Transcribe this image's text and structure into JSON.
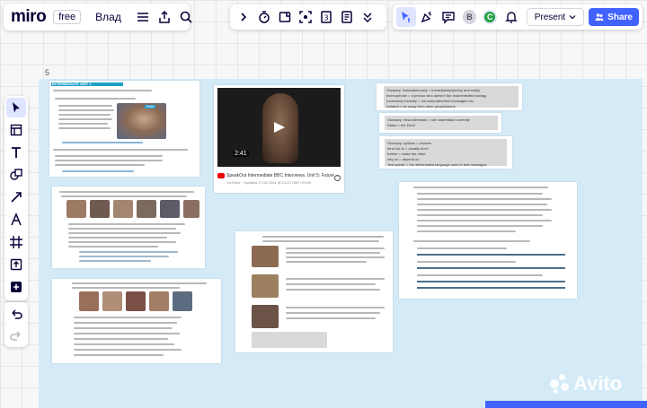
{
  "app": {
    "logo": "miro",
    "plan_badge": "free",
    "board_name": "Влад"
  },
  "toolbar_center": {
    "icons": [
      "chevron-right-icon",
      "timer-icon",
      "voting-icon",
      "focus-icon",
      "number-icon",
      "notes-icon",
      "more-icon"
    ],
    "number_label": "3"
  },
  "toolbar_right": {
    "avatar_b": "B",
    "avatar_c": "C",
    "present_label": "Present",
    "share_label": "Share",
    "colors": {
      "share_bg": "#4262ff",
      "avatar_c_bg": "#25a244",
      "avatar_b_bg": "#d5d5e0"
    }
  },
  "left_tools": [
    "select-icon",
    "template-icon",
    "text-icon",
    "shapes-icon",
    "connector-icon",
    "pen-icon",
    "frame-icon",
    "upload-icon",
    "add-icon"
  ],
  "zoom_label": "5",
  "sheet1": {
    "title": "INTERMEDIATE UNIT 1",
    "video_caption": "Peter"
  },
  "video": {
    "duration": "2:41",
    "title": "SpeakOut Intermediate BBC Interviews. Unit 5: Future ...",
    "subtitle": "YouTube · Updated 27.06.2024 @ 21:22 GMT+03:00"
  },
  "notes": {
    "n1_lines": [
      "Glossary: instantaneously = immediately/quickly and easily",
      "technophobe = a person who doesn't like machines/technology",
      "(unmuted) instantly = via computers/text messages etc",
      "isolated = far away from other people/alone"
    ],
    "n2_lines": [
      "Glossary: misunderstand = not understand correctly",
      "Satan = the Devil"
    ],
    "n3_lines": [
      "Glossary: options = choices",
      "tend not to = usually don't",
      "bother = make the effort",
      "rely on = depend on",
      "'text-speak' = the abbreviated language used in text messages"
    ]
  },
  "watermark": "Avito"
}
